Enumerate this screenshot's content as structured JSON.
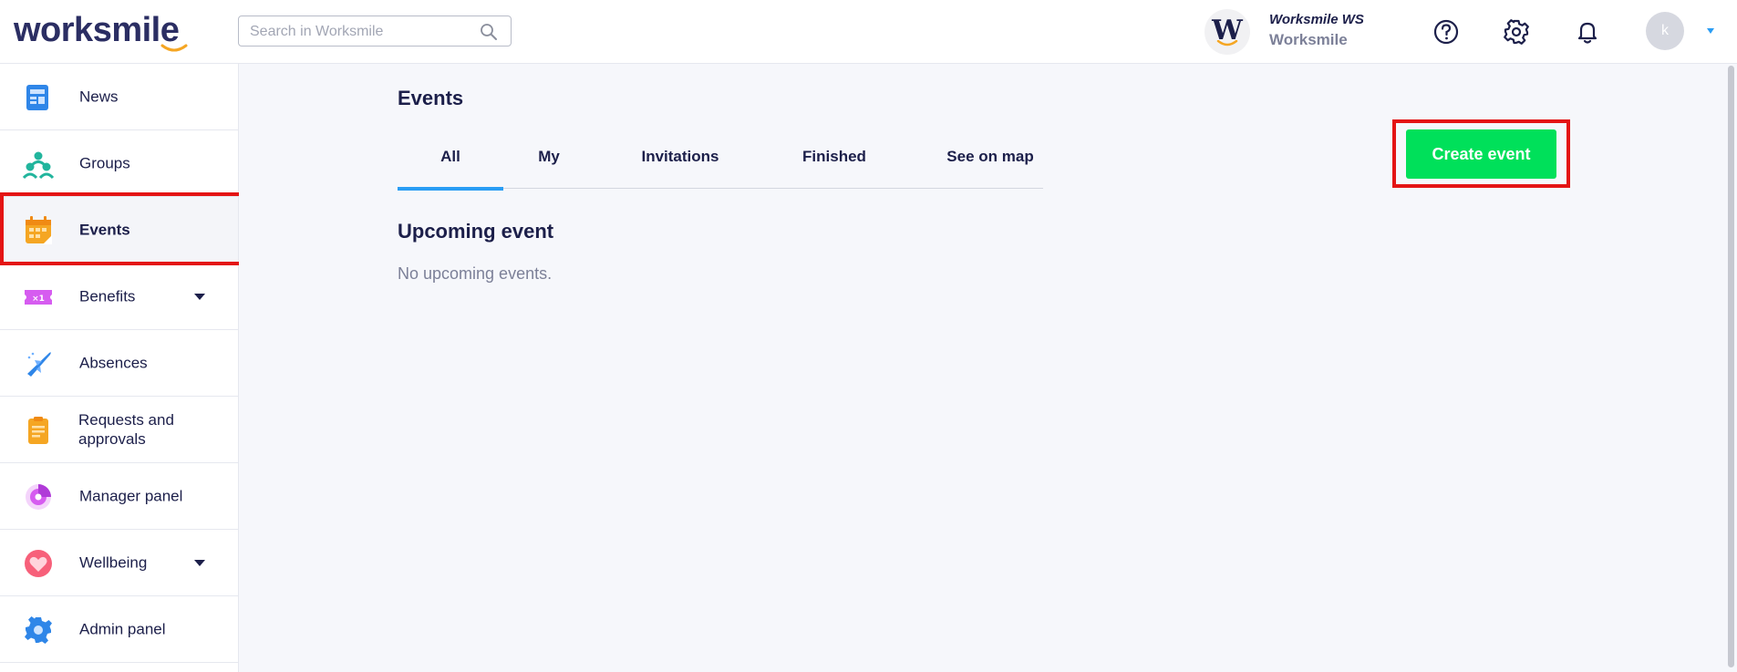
{
  "header": {
    "logo_text": "worksmile",
    "search_placeholder": "Search in Worksmile",
    "org_name": "Worksmile WS",
    "org_subtitle": "Worksmile",
    "org_logo_letter": "W",
    "avatar_initial": "k",
    "icons": [
      "search-icon",
      "help-icon",
      "gear-icon",
      "bell-icon",
      "caret-down-icon"
    ]
  },
  "sidebar": {
    "items": [
      {
        "label": "News",
        "icon": "news-icon",
        "active": false,
        "expandable": false
      },
      {
        "label": "Groups",
        "icon": "groups-icon",
        "active": false,
        "expandable": false
      },
      {
        "label": "Events",
        "icon": "events-icon",
        "active": true,
        "expandable": false
      },
      {
        "label": "Benefits",
        "icon": "benefits-icon",
        "active": false,
        "expandable": true
      },
      {
        "label": "Absences",
        "icon": "plane-icon",
        "active": false,
        "expandable": false
      },
      {
        "label": "Requests and approvals",
        "icon": "clipboard-icon",
        "active": false,
        "expandable": false
      },
      {
        "label": "Manager panel",
        "icon": "manager-panel-icon",
        "active": false,
        "expandable": false
      },
      {
        "label": "Wellbeing",
        "icon": "heart-icon",
        "active": false,
        "expandable": true
      },
      {
        "label": "Admin panel",
        "icon": "admin-gear-icon",
        "active": false,
        "expandable": false
      }
    ]
  },
  "main": {
    "title": "Events",
    "tabs": [
      {
        "label": "All",
        "active": true
      },
      {
        "label": "My",
        "active": false
      },
      {
        "label": "Invitations",
        "active": false
      },
      {
        "label": "Finished",
        "active": false
      },
      {
        "label": "See on map",
        "active": false
      }
    ],
    "create_button": "Create event",
    "section_title": "Upcoming event",
    "empty_message": "No upcoming events."
  },
  "colors": {
    "brand_navy": "#2b2e63",
    "accent_orange": "#f5a623",
    "tab_active": "#2a9df4",
    "create_green": "#00e05a",
    "annotation_red": "#e41414",
    "main_bg": "#f6f7fb"
  }
}
